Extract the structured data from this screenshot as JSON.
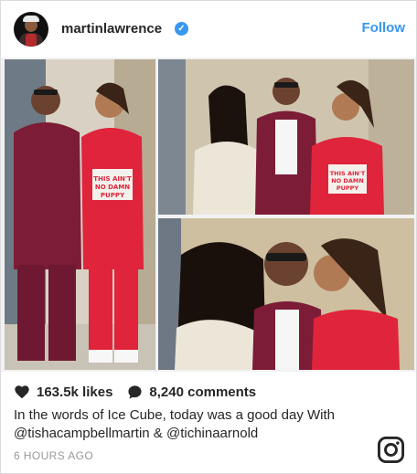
{
  "header": {
    "username": "martinlawrence",
    "verified_icon": "verified-badge-icon",
    "follow_label": "Follow",
    "accent_color": "#3897f0"
  },
  "photos": {
    "shirt_text": "THIS AIN'T NO DAMN PUPPY",
    "shirt_text_short": "THIS AIN'T NO DAMN PUPPY"
  },
  "footer": {
    "likes": "163.5k likes",
    "comments": "8,240 comments",
    "caption_line1": "In the words of Ice Cube, today was a good day With",
    "caption_line2_mention1": "@tishacampbellmartin",
    "caption_line2_amp": " & ",
    "caption_line2_mention2": "@tichinaarnold",
    "timestamp": "6 HOURS AGO"
  }
}
